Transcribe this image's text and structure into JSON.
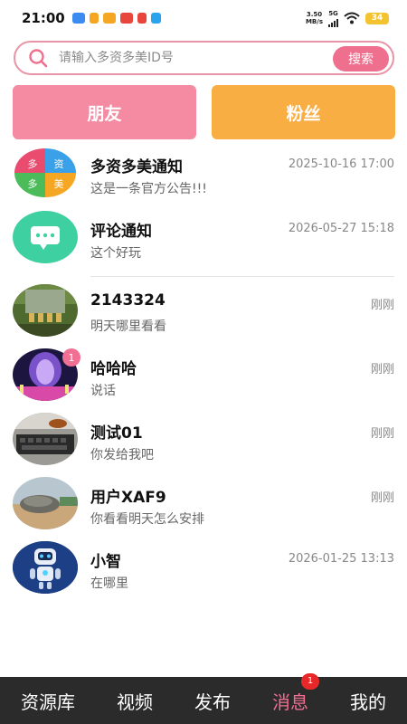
{
  "status_bar": {
    "time": "21:00",
    "net_speed_value": "3.50",
    "net_speed_unit": "MB/s",
    "network": "5G",
    "battery": "34",
    "app_colors": [
      "#3b8cf0",
      "#f5a623",
      "#f5a623",
      "#e8453c",
      "#e8453c",
      "#2aa3ef"
    ]
  },
  "search": {
    "placeholder": "请输入多资多美ID号",
    "button_label": "搜索"
  },
  "tabs": {
    "friends_label": "朋友",
    "fans_label": "粉丝"
  },
  "messages": [
    {
      "title": "多资多美通知",
      "time": "2025-10-16 17:00",
      "subtitle": "这是一条官方公告!!!",
      "avatar": "logo-avatar",
      "avatar_chars": [
        "多",
        "资",
        "多",
        "美"
      ]
    },
    {
      "title": "评论通知",
      "time": "2026-05-27 15:18",
      "subtitle": "这个好玩",
      "avatar": "comment-bubble-icon"
    },
    {
      "title": "2143324",
      "time": "刚刚",
      "subtitle": "明天哪里看看",
      "avatar": "photo-avatar"
    },
    {
      "title": "哈哈哈",
      "time": "刚刚",
      "subtitle": "说话",
      "avatar": "photo-avatar",
      "unread": "1"
    },
    {
      "title": "测试01",
      "time": "刚刚",
      "subtitle": "你发给我吧",
      "avatar": "photo-avatar"
    },
    {
      "title": "用户XAF9",
      "time": "刚刚",
      "subtitle": "你看看明天怎么安排",
      "avatar": "photo-avatar"
    },
    {
      "title": "小智",
      "time": "2026-01-25 13:13",
      "subtitle": "在哪里",
      "avatar": "robot-avatar"
    }
  ],
  "bottom_nav": {
    "items": [
      "资源库",
      "视频",
      "发布",
      "消息",
      "我的"
    ],
    "active": "消息",
    "message_badge": "1"
  },
  "colors": {
    "accent_pink": "#ee6f8e",
    "friends_tab": "#f48ba2",
    "fans_tab": "#f9ae44",
    "nav_bg": "#2b2b2b"
  }
}
